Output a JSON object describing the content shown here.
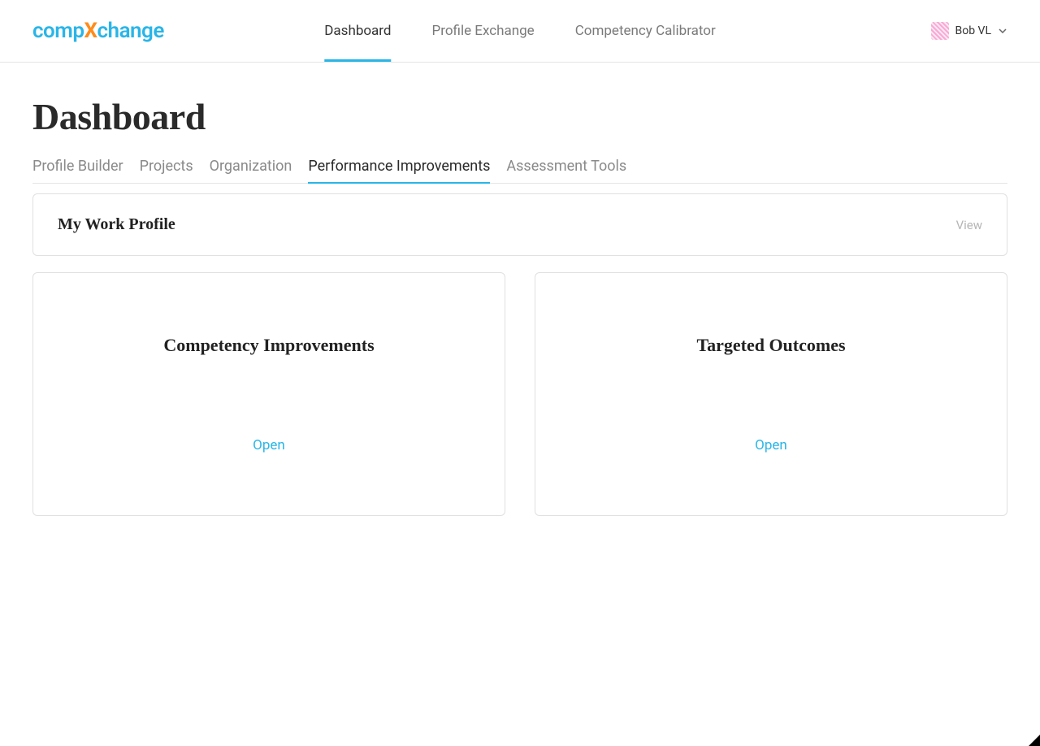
{
  "logo": {
    "part1": "comp",
    "part2": "X",
    "part3": "change"
  },
  "topNav": {
    "items": [
      {
        "label": "Dashboard",
        "active": true
      },
      {
        "label": "Profile Exchange",
        "active": false
      },
      {
        "label": "Competency Calibrator",
        "active": false
      }
    ]
  },
  "user": {
    "name": "Bob VL"
  },
  "page": {
    "title": "Dashboard"
  },
  "subTabs": {
    "items": [
      {
        "label": "Profile Builder",
        "active": false
      },
      {
        "label": "Projects",
        "active": false
      },
      {
        "label": "Organization",
        "active": false
      },
      {
        "label": "Performance Improvements",
        "active": true
      },
      {
        "label": "Assessment Tools",
        "active": false
      }
    ]
  },
  "profileCard": {
    "title": "My Work Profile",
    "action": "View"
  },
  "cards": [
    {
      "title": "Competency Improvements",
      "action": "Open"
    },
    {
      "title": "Targeted Outcomes",
      "action": "Open"
    }
  ]
}
